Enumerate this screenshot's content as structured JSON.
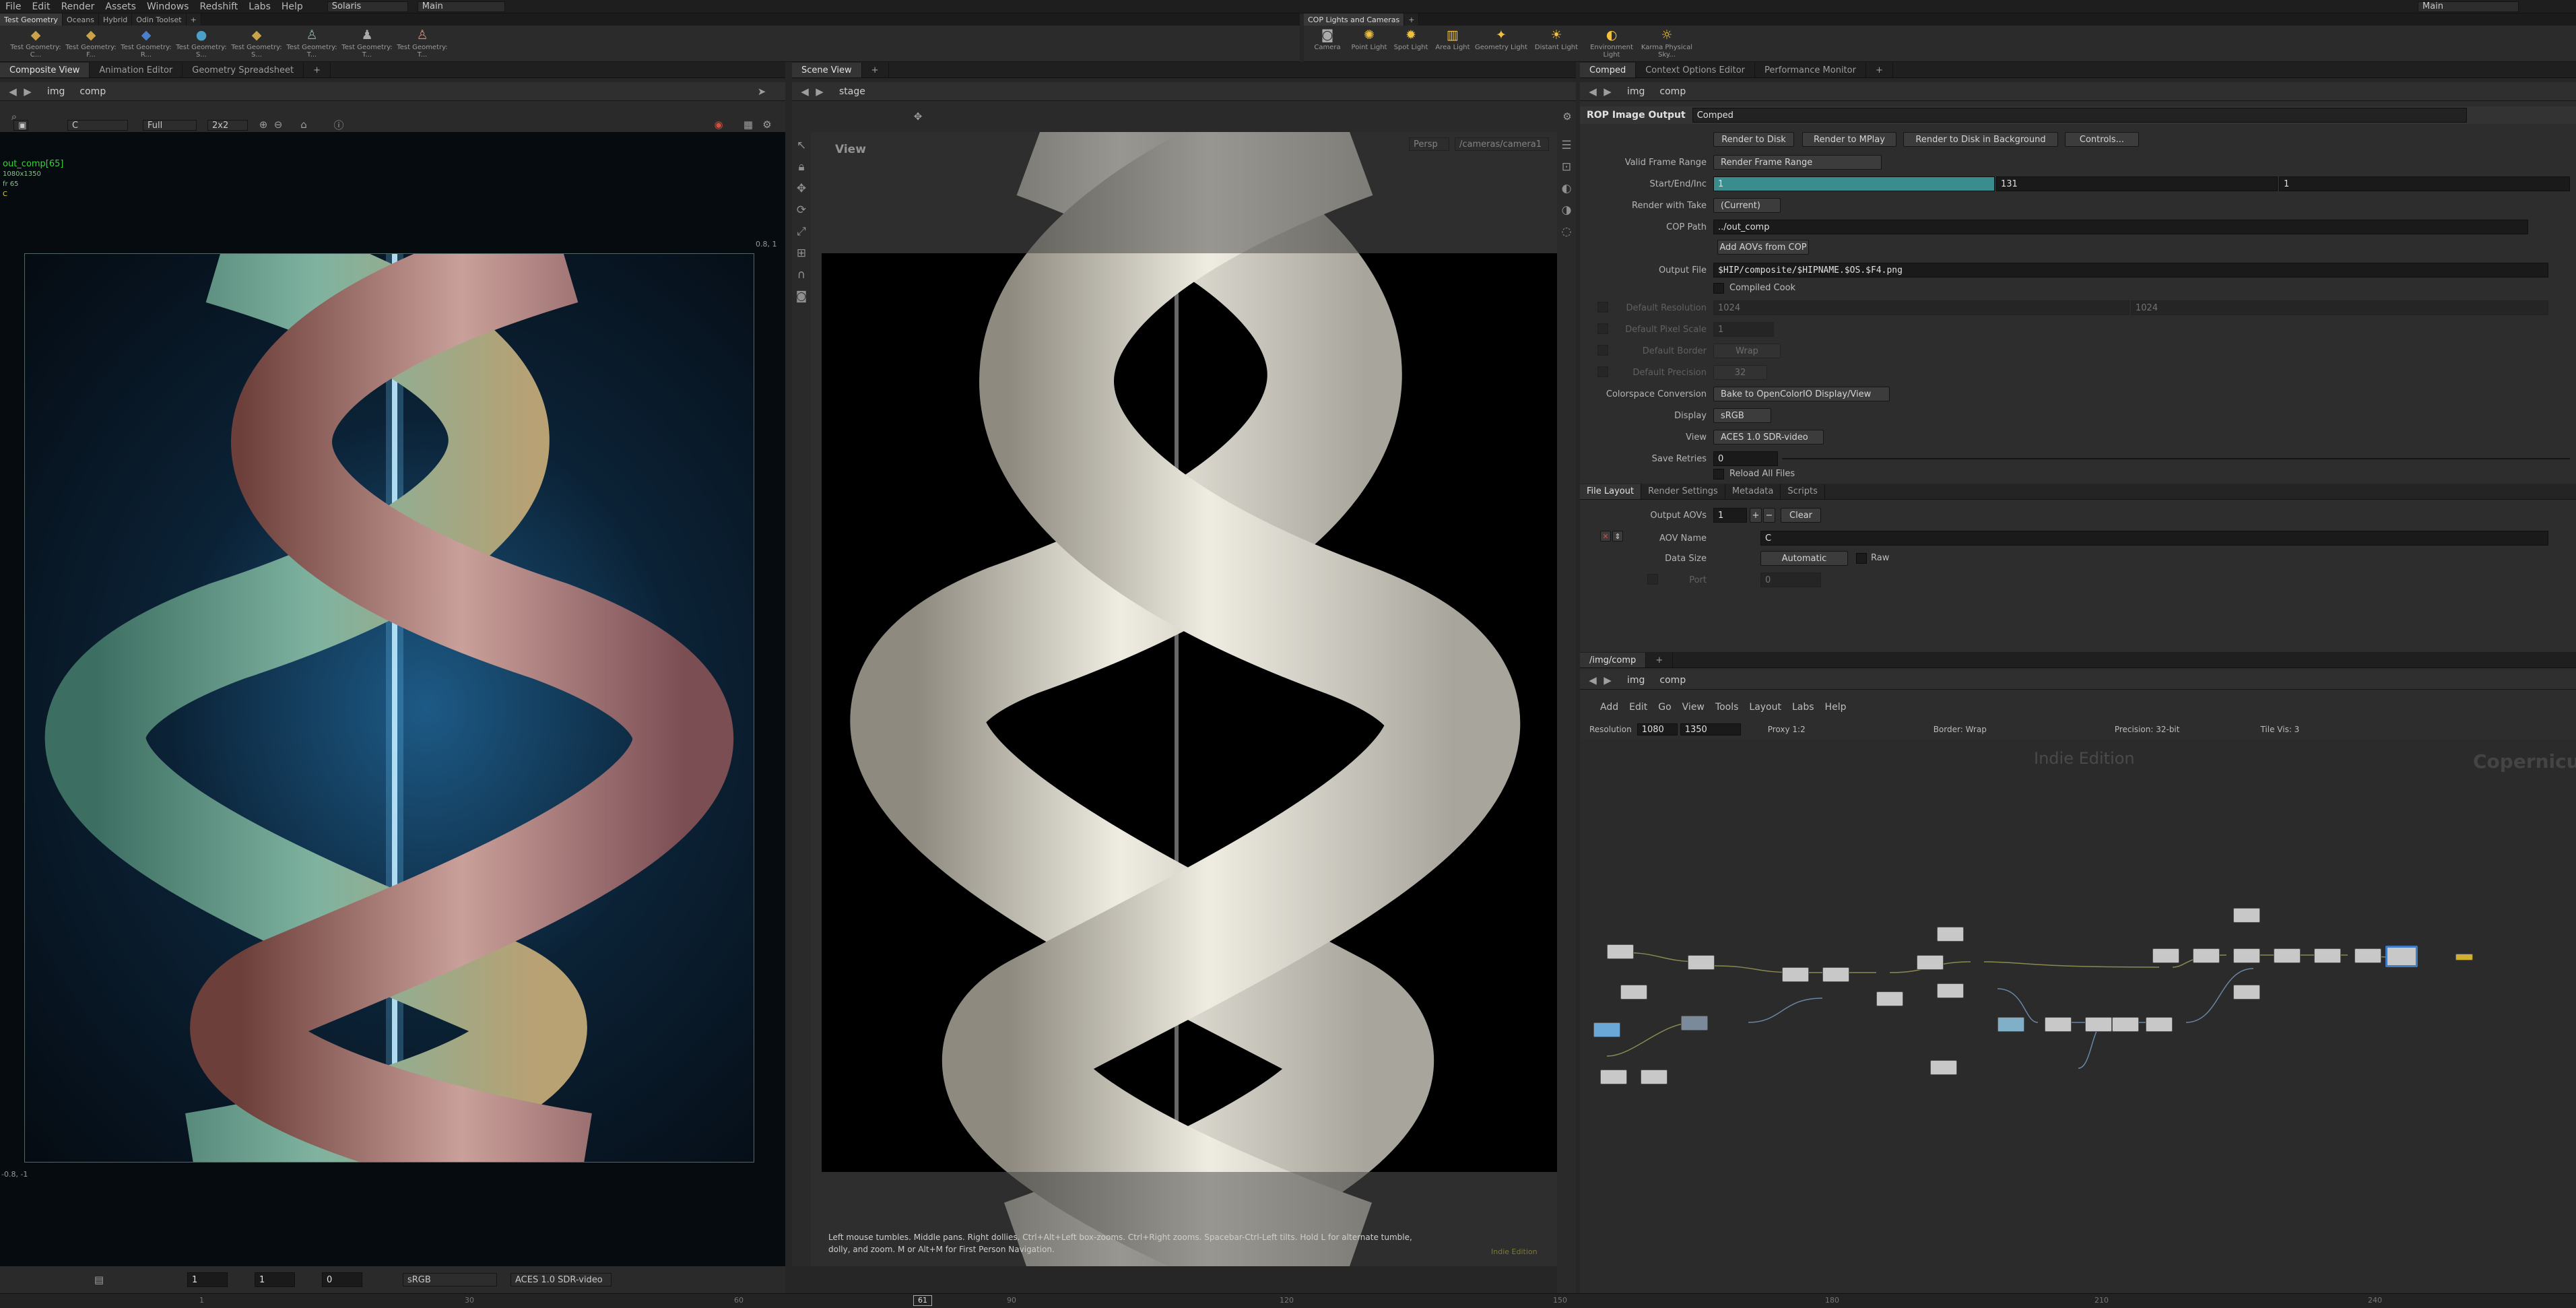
{
  "menubar": {
    "items": [
      "File",
      "Edit",
      "Render",
      "Assets",
      "Windows",
      "Redshift",
      "Labs",
      "Help"
    ],
    "desktop": "Solaris",
    "context": "Main",
    "right_dd": "Main"
  },
  "shelf_left": {
    "tabs": [
      "Test Geometry",
      "Oceans",
      "Hybrid",
      "Odin Toolset"
    ],
    "tools": [
      "Test Geometry: C...",
      "Test Geometry: F...",
      "Test Geometry: R...",
      "Test Geometry: S...",
      "Test Geometry: S...",
      "Test Geometry: T...",
      "Test Geometry: T...",
      "Test Geometry: T..."
    ]
  },
  "shelf_right": {
    "tabs": [
      "COP Lights and Cameras"
    ],
    "tools": [
      "Camera",
      "Point Light",
      "Spot Light",
      "Area Light",
      "Geometry Light",
      "Distant Light",
      "Environment Light",
      "Karma Physical Sky..."
    ]
  },
  "left_pane": {
    "tabs": [
      "Composite View",
      "Animation Editor",
      "Geometry Spreadsheet"
    ],
    "path": [
      "img",
      "comp"
    ],
    "toolbar": {
      "channel": "C",
      "res": "Full",
      "split": "2x2"
    },
    "overlay": {
      "name": "out_comp[65]",
      "size": "1080x1350",
      "frame": "fr 65",
      "ch": "C",
      "corner_tr": "0.8, 1",
      "corner_bl": "-0.8, -1"
    },
    "bottom": {
      "a": "1",
      "b": "1",
      "c": "0",
      "display": "sRGB",
      "view": "ACES 1.0 SDR-video"
    }
  },
  "scene_pane": {
    "tabs": [
      "Scene View"
    ],
    "path": [
      "stage"
    ],
    "view_label": "View",
    "persp": "Persp",
    "camera": "/cameras/camera1",
    "hint": "Left mouse tumbles. Middle pans. Right dollies. Ctrl+Alt+Left box-zooms. Ctrl+Right zooms. Spacebar-Ctrl-Left tilts. Hold L for alternate tumble, dolly, and zoom. M or Alt+M for First Person Navigation.",
    "edition": "Indie Edition"
  },
  "params_pane": {
    "tabs": [
      "Comped",
      "Context Options Editor",
      "Performance Monitor"
    ],
    "path": [
      "img",
      "comp"
    ],
    "node_type": "ROP Image Output",
    "node_name": "Comped",
    "buttons": [
      "Render to Disk",
      "Render to MPlay",
      "Render to Disk in Background",
      "Controls..."
    ],
    "valid_frame_range": {
      "label": "Valid Frame Range",
      "value": "Render Frame Range"
    },
    "start_end": {
      "label": "Start/End/Inc",
      "start": "1",
      "end": "131",
      "inc": "1"
    },
    "take": {
      "label": "Render with Take",
      "value": "(Current)"
    },
    "cop_path": {
      "label": "COP Path",
      "value": "../out_comp"
    },
    "add_aovs": "Add AOVs from COP",
    "output_file": {
      "label": "Output File",
      "value": "$HIP/composite/$HIPNAME.$OS.$F4.png"
    },
    "compiled_cook": "Compiled Cook",
    "def_res": {
      "label": "Default Resolution",
      "a": "1024",
      "b": "1024"
    },
    "def_pix": {
      "label": "Default Pixel Scale",
      "a": "1"
    },
    "def_border": {
      "label": "Default Border",
      "a": "Wrap"
    },
    "def_prec": {
      "label": "Default Precision",
      "a": "32"
    },
    "colorspace": {
      "label": "Colorspace Conversion",
      "value": "Bake to OpenColorIO Display/View"
    },
    "display": {
      "label": "Display",
      "value": "sRGB"
    },
    "view": {
      "label": "View",
      "value": "ACES 1.0 SDR-video"
    },
    "save_retries": {
      "label": "Save Retries",
      "value": "0"
    },
    "reload": "Reload All Files",
    "subtabs": [
      "File Layout",
      "Render Settings",
      "Metadata",
      "Scripts"
    ],
    "output_aovs": {
      "label": "Output AOVs",
      "value": "1",
      "clear": "Clear"
    },
    "aov_name": {
      "label": "AOV Name",
      "value": "C"
    },
    "data_size": {
      "label": "Data Size",
      "value": "Automatic",
      "raw": "Raw"
    },
    "port": {
      "label": "Port",
      "value": "0"
    }
  },
  "network_pane": {
    "tab": "/img/comp",
    "path": [
      "img",
      "comp"
    ],
    "menu": [
      "Add",
      "Edit",
      "Go",
      "View",
      "Tools",
      "Layout",
      "Labs",
      "Help"
    ],
    "info": {
      "res_label": "Resolution",
      "w": "1080",
      "h": "1350",
      "proxy": "Proxy 1:2",
      "border": "Border: Wrap",
      "precision": "Precision: 32-bit",
      "tile": "Tile Vis: 3"
    },
    "watermark_edition": "Indie Edition",
    "watermark_ctx": "Copernicus"
  },
  "timeline": {
    "ticks": [
      "1",
      "30",
      "60",
      "90",
      "120",
      "150",
      "180",
      "210",
      "240"
    ],
    "current": "61"
  },
  "colors": {
    "accent_teal": "#3b8c8c",
    "node_sel": "#3e7bc4",
    "ui_bg": "#262626"
  }
}
